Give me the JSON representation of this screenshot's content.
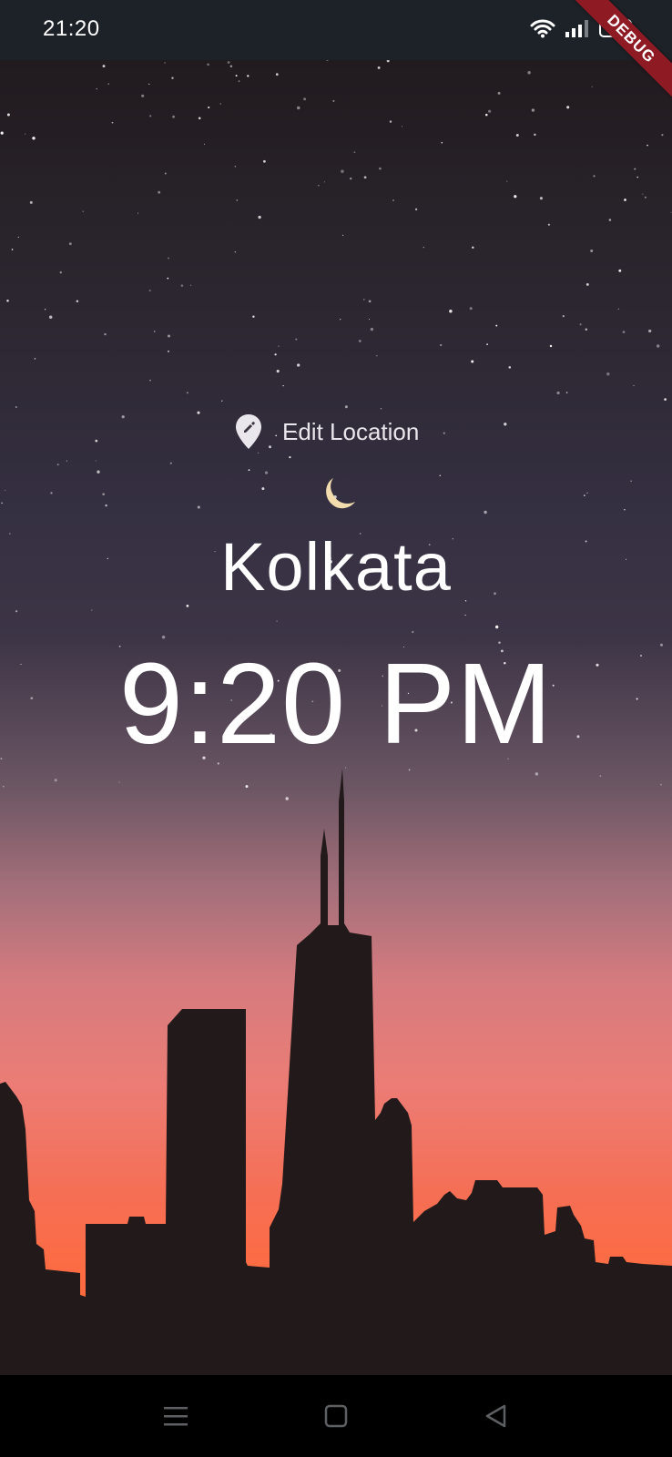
{
  "status_bar": {
    "time": "21:20",
    "battery_level": "100"
  },
  "debug_ribbon": {
    "label": "DEBUG"
  },
  "main": {
    "edit_location_label": "Edit Location",
    "edit_location_icon": "edit-location-icon",
    "day_night_icon": "crescent-moon-icon",
    "city": "Kolkata",
    "time": "9:20 PM"
  },
  "nav_bar": {
    "buttons": [
      "menu-icon",
      "home-icon",
      "back-icon"
    ]
  },
  "colors": {
    "status_bar_bg": "#1d2228",
    "text_primary": "#ffffff",
    "moon": "#f2dcae",
    "debug_ribbon": "#8e1b24",
    "skyline": "#221a1a",
    "sky_top": "#211b1f",
    "sky_bottom": "#ff6a3d"
  }
}
